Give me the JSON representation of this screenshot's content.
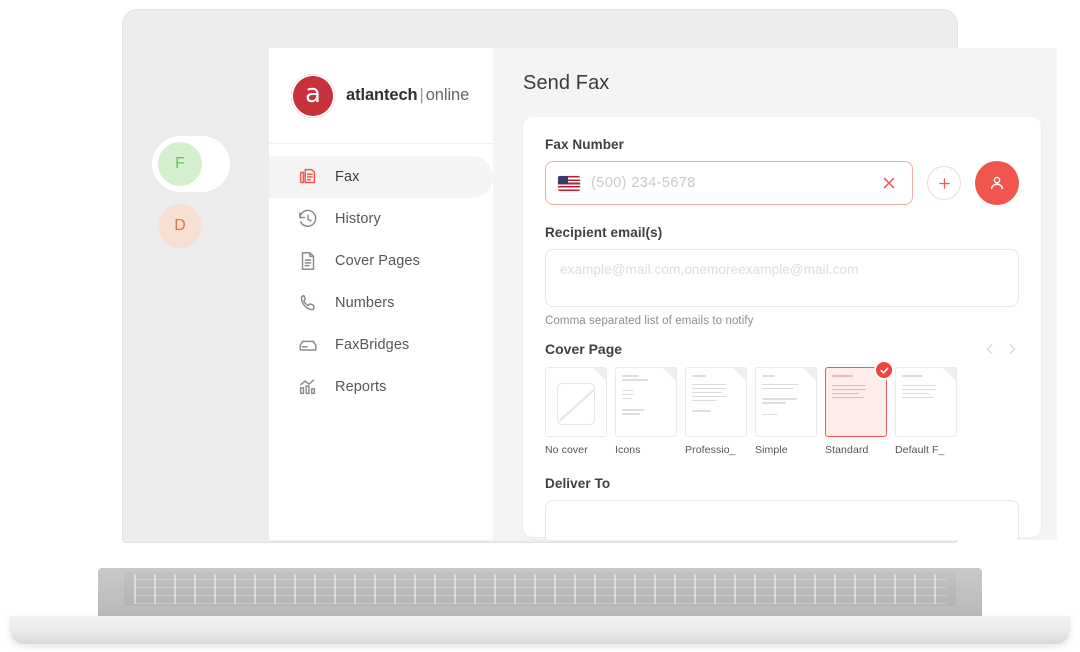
{
  "brand": {
    "logo_letter": "a",
    "name_primary": "atlantech",
    "separator": "|",
    "name_secondary": "online",
    "logo_color": "#c8303c"
  },
  "sidebar": {
    "items": [
      {
        "label": "Fax",
        "icon": "fax-icon",
        "active": true
      },
      {
        "label": "History",
        "icon": "history-icon",
        "active": false
      },
      {
        "label": "Cover Pages",
        "icon": "document-icon",
        "active": false
      },
      {
        "label": "Numbers",
        "icon": "phone-icon",
        "active": false
      },
      {
        "label": "FaxBridges",
        "icon": "faxbridge-icon",
        "active": false
      },
      {
        "label": "Reports",
        "icon": "chart-icon",
        "active": false
      }
    ]
  },
  "avatars": [
    {
      "initial": "F",
      "bg": "#d5f0cf",
      "fg": "#68c25a"
    },
    {
      "initial": "D",
      "bg": "#f7dfd2",
      "fg": "#cf7a4d"
    }
  ],
  "main": {
    "page_title": "Send Fax",
    "fax_number": {
      "label": "Fax Number",
      "value": "",
      "placeholder": "(500) 234-5678",
      "country_flag": "us-flag-icon",
      "clear_label": "×",
      "add_label": "+",
      "contacts_label": "contacts"
    },
    "recipient_email": {
      "label": "Recipient email(s)",
      "value": "",
      "placeholder": "example@mail.com,onemoreexample@mail.com",
      "help": "Comma separated list of emails to notify"
    },
    "cover_page": {
      "label": "Cover Page",
      "prev_label": "‹",
      "next_label": "›",
      "options": [
        {
          "label": "No cover",
          "selected": false,
          "style": "no-cover"
        },
        {
          "label": "Icons",
          "selected": false,
          "style": "icons"
        },
        {
          "label": "Professio_",
          "selected": false,
          "style": "professional"
        },
        {
          "label": "Simple",
          "selected": false,
          "style": "simple"
        },
        {
          "label": "Standard",
          "selected": true,
          "style": "standard"
        },
        {
          "label": "Default F_",
          "selected": false,
          "style": "default"
        }
      ]
    },
    "deliver_to": {
      "label": "Deliver To",
      "value": ""
    }
  },
  "colors": {
    "accent_red": "#f0584f",
    "brand_crimson": "#c8303c",
    "page_bg": "#f4f4f5"
  }
}
